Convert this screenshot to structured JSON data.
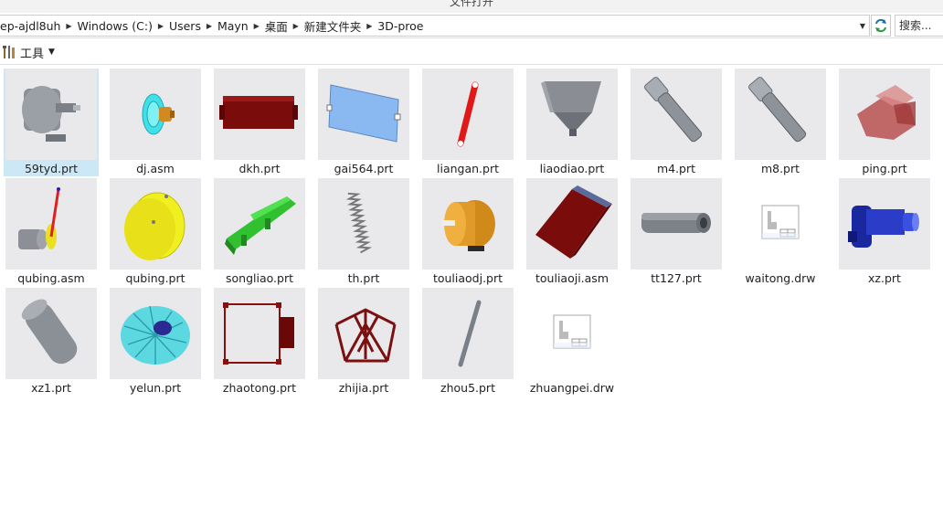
{
  "window": {
    "title": "文件打开"
  },
  "address": {
    "crumbs": [
      "ep-ajdl8uh",
      "Windows (C:)",
      "Users",
      "Mayn",
      "桌面",
      "新建文件夹",
      "3D-proe"
    ],
    "search_placeholder": "搜索..."
  },
  "toolbar": {
    "tools_label": "工具"
  },
  "files": [
    {
      "name": "59tyd.prt",
      "icon": "motor-icon",
      "selected": true
    },
    {
      "name": "dj.asm",
      "icon": "fan-motor-icon"
    },
    {
      "name": "dkh.prt",
      "icon": "red-box-icon"
    },
    {
      "name": "gai564.prt",
      "icon": "blue-plate-icon"
    },
    {
      "name": "liangan.prt",
      "icon": "red-link-icon"
    },
    {
      "name": "liaodiao.prt",
      "icon": "hopper-icon"
    },
    {
      "name": "m4.prt",
      "icon": "bolt-icon"
    },
    {
      "name": "m8.prt",
      "icon": "bolt-icon"
    },
    {
      "name": "ping.prt",
      "icon": "red-shell-icon"
    },
    {
      "name": "qubing.asm",
      "icon": "crank-assembly-icon"
    },
    {
      "name": "qubing.prt",
      "icon": "yellow-disc-icon"
    },
    {
      "name": "songliao.prt",
      "icon": "green-frame-icon"
    },
    {
      "name": "th.prt",
      "icon": "spring-icon"
    },
    {
      "name": "touliaodj.prt",
      "icon": "orange-motor-icon"
    },
    {
      "name": "touliaoji.asm",
      "icon": "red-block-icon"
    },
    {
      "name": "tt127.prt",
      "icon": "tube-icon"
    },
    {
      "name": "waitong.drw",
      "icon": "drawing-icon"
    },
    {
      "name": "xz.prt",
      "icon": "blue-shaft-icon"
    },
    {
      "name": "xz1.prt",
      "icon": "cylinder-icon"
    },
    {
      "name": "yelun.prt",
      "icon": "impeller-icon"
    },
    {
      "name": "zhaotong.prt",
      "icon": "red-frame-icon"
    },
    {
      "name": "zhijia.prt",
      "icon": "truss-icon"
    },
    {
      "name": "zhou5.prt",
      "icon": "rod-icon"
    },
    {
      "name": "zhuangpei.drw",
      "icon": "drawing-icon"
    }
  ]
}
